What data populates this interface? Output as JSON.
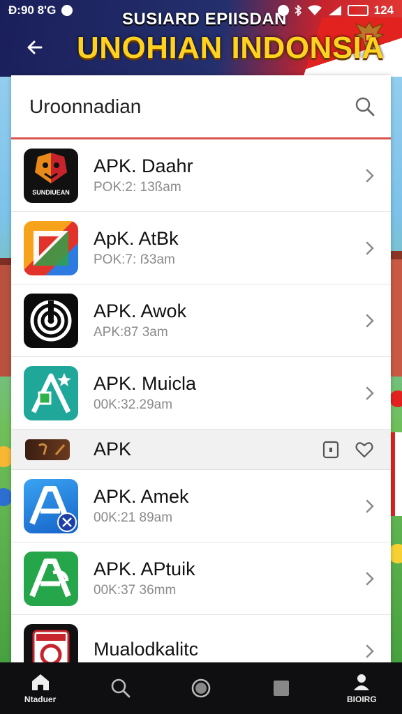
{
  "status_bar": {
    "time": "Ð:90 8'G",
    "battery_level": "124"
  },
  "header": {
    "subtitle": "SUSIARD EPIISDAN",
    "title": "UNOHIAN INDONSIA"
  },
  "search": {
    "text": "Uroonnadian"
  },
  "apps": [
    {
      "name": "APK. Daahr",
      "meta": "POK:2: 13ßam",
      "icon": "sundhian-logo-icon",
      "icon_caption": "SUNDIUEAN"
    },
    {
      "name": "ApK. AtBk",
      "meta": "POK:7: ẞ3am",
      "icon": "play-store-icon"
    },
    {
      "name": "APK. Awok",
      "meta": "APK:87 3am",
      "icon": "spiral-icon"
    },
    {
      "name": "APK. Muicla",
      "meta": "00K:32.29am",
      "icon": "sketch-a-icon"
    }
  ],
  "section": {
    "label": "APK"
  },
  "apps_more": [
    {
      "name": "APK. Amek",
      "meta": "00K:21 89am",
      "icon": "blue-a-icon"
    },
    {
      "name": "APK. APtuik",
      "meta": "00K:37 36mm",
      "icon": "green-a-icon"
    },
    {
      "name": "Mualodkalitc",
      "meta": "",
      "icon": "card-icon"
    }
  ],
  "bottom_nav": [
    {
      "label": "Ntaduer",
      "icon": "home-icon"
    },
    {
      "label": "",
      "icon": "search-icon"
    },
    {
      "label": "",
      "icon": "circle-icon"
    },
    {
      "label": "",
      "icon": "square-icon"
    },
    {
      "label": "BIOIRG",
      "icon": "profile-icon"
    }
  ],
  "colors": {
    "header_navy": "#1a1f5a",
    "header_gold": "#ffd21f",
    "flag_red": "#e2221f",
    "search_underline": "#d9534f",
    "nav_bg": "#0f0f12"
  }
}
